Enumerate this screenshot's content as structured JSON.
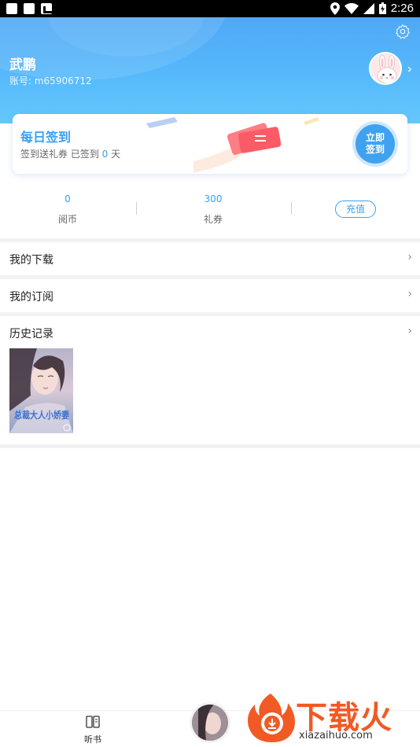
{
  "status_bar": {
    "time": "2:26"
  },
  "header": {
    "username": "武鹏",
    "account": "账号: m65906712"
  },
  "checkin": {
    "title": "每日签到",
    "subtitle_prefix": "签到送礼券 已签到 ",
    "days": "0",
    "subtitle_suffix": " 天",
    "button_line1": "立即",
    "button_line2": "签到"
  },
  "stats": [
    {
      "value": "0",
      "label": "阅币"
    },
    {
      "value": "300",
      "label": "礼券"
    }
  ],
  "recharge_label": "充值",
  "menu": {
    "downloads": "我的下载",
    "subscriptions": "我的订阅",
    "history": "历史记录"
  },
  "history": [
    {
      "cover_title": "总裁大人小娇妻"
    }
  ],
  "bottom_nav": {
    "listen_label": "听书"
  },
  "watermark": {
    "brand": "下载火",
    "url": "xiazaihuo.com"
  },
  "colors": {
    "accent": "#3aa0ef",
    "header_top": "#4fa8f6",
    "header_bottom": "#64c8fc",
    "watermark": "#f15a24"
  }
}
